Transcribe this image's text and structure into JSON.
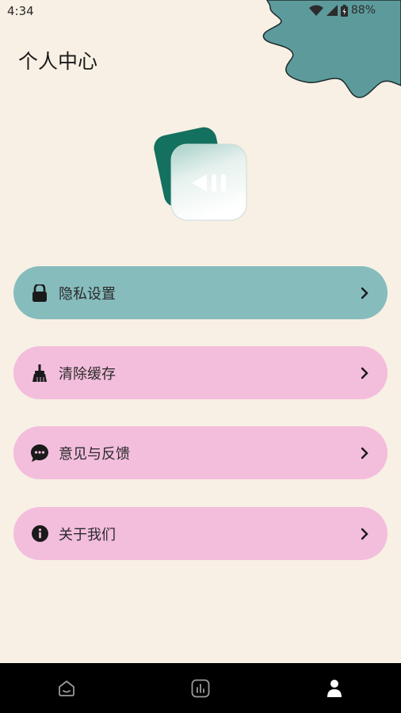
{
  "status": {
    "time": "4:34",
    "battery": "88%"
  },
  "header": {
    "title": "个人中心"
  },
  "menu": [
    {
      "label": "隐私设置",
      "icon": "lock-icon",
      "color": "#87bcbd"
    },
    {
      "label": "清除缓存",
      "icon": "broom-icon",
      "color": "#f3bddc"
    },
    {
      "label": "意见与反馈",
      "icon": "chat-icon",
      "color": "#f3bddc"
    },
    {
      "label": "关于我们",
      "icon": "info-icon",
      "color": "#f3bddc"
    }
  ],
  "nav": [
    {
      "icon": "home-icon",
      "active": false
    },
    {
      "icon": "stats-icon",
      "active": false
    },
    {
      "icon": "person-icon",
      "active": true
    }
  ],
  "colors": {
    "background": "#f8f0e4",
    "splat": "#5d9a9b",
    "teal": "#87bcbd",
    "pink": "#f3bddc"
  }
}
